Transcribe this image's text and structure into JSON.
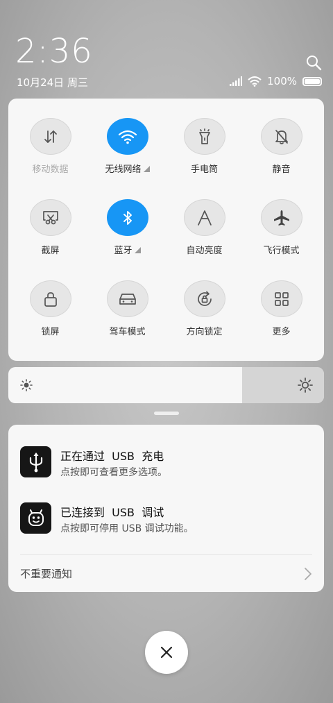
{
  "status_bar": {
    "time": "2:36",
    "date": "10月24日 周三",
    "battery": "100%"
  },
  "quick_settings": {
    "tiles": [
      {
        "id": "mobile-data",
        "label": "移动数据",
        "on": false,
        "dim": true,
        "icon": "arrows-updown-icon"
      },
      {
        "id": "wifi",
        "label": "无线网络",
        "on": true,
        "caret": true,
        "icon": "wifi-icon"
      },
      {
        "id": "flashlight",
        "label": "手电筒",
        "on": false,
        "icon": "flashlight-icon"
      },
      {
        "id": "mute",
        "label": "静音",
        "on": false,
        "icon": "bell-off-icon"
      },
      {
        "id": "screenshot",
        "label": "截屏",
        "on": false,
        "icon": "scissors-icon"
      },
      {
        "id": "bluetooth",
        "label": "蓝牙",
        "on": true,
        "caret": true,
        "icon": "bluetooth-icon"
      },
      {
        "id": "auto-brightness",
        "label": "自动亮度",
        "on": false,
        "icon": "auto-brightness-icon"
      },
      {
        "id": "airplane",
        "label": "飞行模式",
        "on": false,
        "icon": "airplane-icon"
      },
      {
        "id": "lock",
        "label": "锁屏",
        "on": false,
        "icon": "lock-icon"
      },
      {
        "id": "driving",
        "label": "驾车模式",
        "on": false,
        "icon": "car-icon"
      },
      {
        "id": "rotation-lock",
        "label": "方向锁定",
        "on": false,
        "icon": "rotation-lock-icon"
      },
      {
        "id": "more",
        "label": "更多",
        "on": false,
        "icon": "grid-icon"
      }
    ]
  },
  "brightness": {
    "level": 0.74
  },
  "notifications": [
    {
      "title": "正在通过  USB  充电",
      "body": "点按即可查看更多选项。",
      "icon": "usb-icon"
    },
    {
      "title": "已连接到  USB  调试",
      "body": "点按即可停用 USB 调试功能。",
      "icon": "android-debug-icon"
    }
  ],
  "unimportant": {
    "label": "不重要通知"
  },
  "colors": {
    "accent": "#1796f5",
    "panel": "#f7f7f7"
  }
}
